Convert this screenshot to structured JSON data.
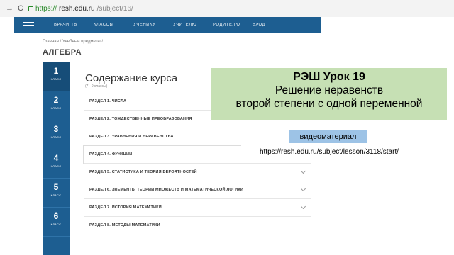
{
  "browser": {
    "back_icon": "→",
    "reload_icon": "C",
    "url_scheme": "https://",
    "url_host": "resh.edu.ru",
    "url_path": "/subject/16/"
  },
  "site_nav": {
    "items": [
      "ВРАЧИ ТВ",
      "КЛАССЫ",
      "УЧЕНИКУ",
      "УЧИТЕЛЮ",
      "РОДИТЕЛЮ",
      "ВХОД"
    ]
  },
  "breadcrumb": "Главная / Учебные предметы /",
  "page_title": "АЛГЕБРА",
  "grades": [
    {
      "number": "1",
      "label": "класс"
    },
    {
      "number": "2",
      "label": "класс"
    },
    {
      "number": "3",
      "label": "класс"
    },
    {
      "number": "4",
      "label": "класс"
    },
    {
      "number": "5",
      "label": "класс"
    },
    {
      "number": "6",
      "label": "класс"
    }
  ],
  "course": {
    "title": "Содержание курса",
    "subtitle": "(7 - 9 классы)",
    "sections": [
      "РАЗДЕЛ 1. ЧИСЛА",
      "РАЗДЕЛ 2. ТОЖДЕСТВЕННЫЕ ПРЕОБРАЗОВАНИЯ",
      "РАЗДЕЛ 3. УРАВНЕНИЯ И НЕРАВЕНСТВА",
      "РАЗДЕЛ 4. ФУНКЦИИ",
      "РАЗДЕЛ 5. СТАТИСТИКА И ТЕОРИЯ ВЕРОЯТНОСТЕЙ",
      "РАЗДЕЛ 6. ЭЛЕМЕНТЫ ТЕОРИИ МНОЖЕСТВ И МАТЕМАТИЧЕСКОЙ ЛОГИКИ",
      "РАЗДЕЛ 7. ИСТОРИЯ МАТЕМАТИКИ",
      "РАЗДЕЛ 8. МЕТОДЫ МАТЕМАТИКИ"
    ]
  },
  "overlay": {
    "lesson_number": "РЭШ Урок 19",
    "topic_line1": "Решение неравенств",
    "topic_line2": "второй степени с одной переменной",
    "video_badge": "видеоматериал",
    "link": "https://resh.edu.ru/subject/lesson/3118/start/"
  },
  "colors": {
    "site_blue": "#1d5e91",
    "card_green": "#c6e0b4",
    "badge_blue": "#9dc3e6"
  }
}
